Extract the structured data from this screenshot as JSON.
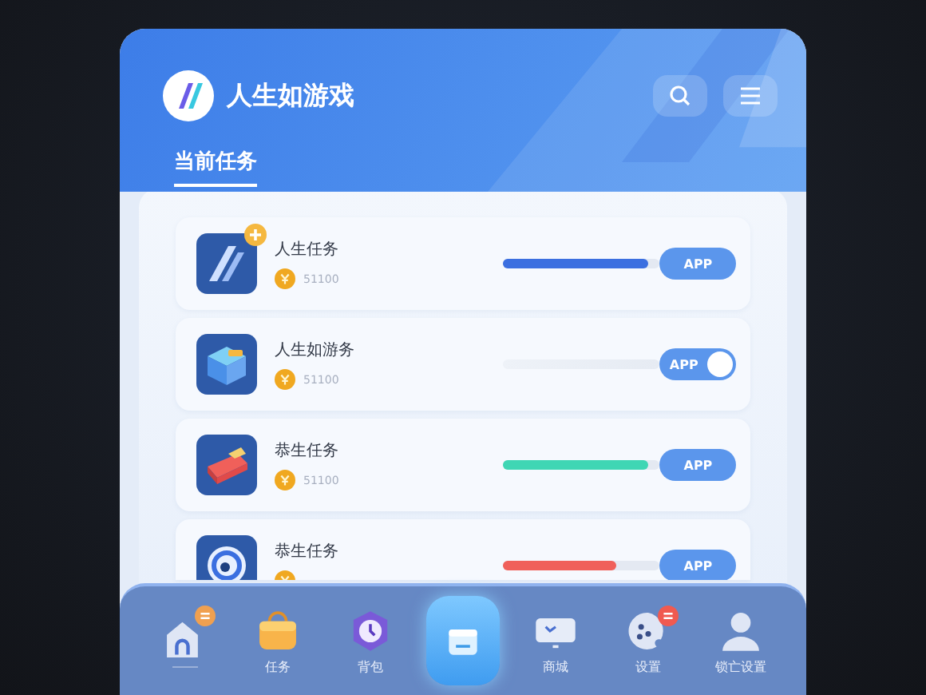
{
  "app": {
    "title": "人生如游戏"
  },
  "tabs": [
    {
      "label": "当前任务",
      "selected": true
    }
  ],
  "tasks": [
    {
      "name": "人生任务",
      "amount": "51100",
      "kind": "progress",
      "level": 0.92,
      "color": "#3b6fe0",
      "button": "APP",
      "badge": true
    },
    {
      "name": "人生如游务",
      "amount": "51100",
      "kind": "toggle",
      "on": true,
      "button": "APP",
      "badge": false
    },
    {
      "name": "恭生任务",
      "amount": "51100",
      "kind": "progress",
      "level": 0.92,
      "color": "#3fd6b4",
      "button": "APP",
      "badge": false
    },
    {
      "name": "恭生任务",
      "kind": "progress",
      "level": 0.72,
      "color": "#f0605a",
      "button": "APP",
      "badge": false
    }
  ],
  "nav": [
    {
      "selected": false,
      "badge": true,
      "underline": true
    },
    {
      "label": "任务",
      "selected": false,
      "badge": false,
      "underline": false
    },
    {
      "label": "背包",
      "selected": false,
      "badge": false,
      "underline": false
    },
    {
      "selected": true,
      "badge": false,
      "underline": false
    },
    {
      "label": "商城",
      "selected": false,
      "badge": false,
      "underline": false
    },
    {
      "label": "设置",
      "selected": false,
      "badge": true,
      "underline": false
    },
    {
      "label": "锁亡设置",
      "selected": false,
      "badge": false,
      "underline": false
    }
  ]
}
